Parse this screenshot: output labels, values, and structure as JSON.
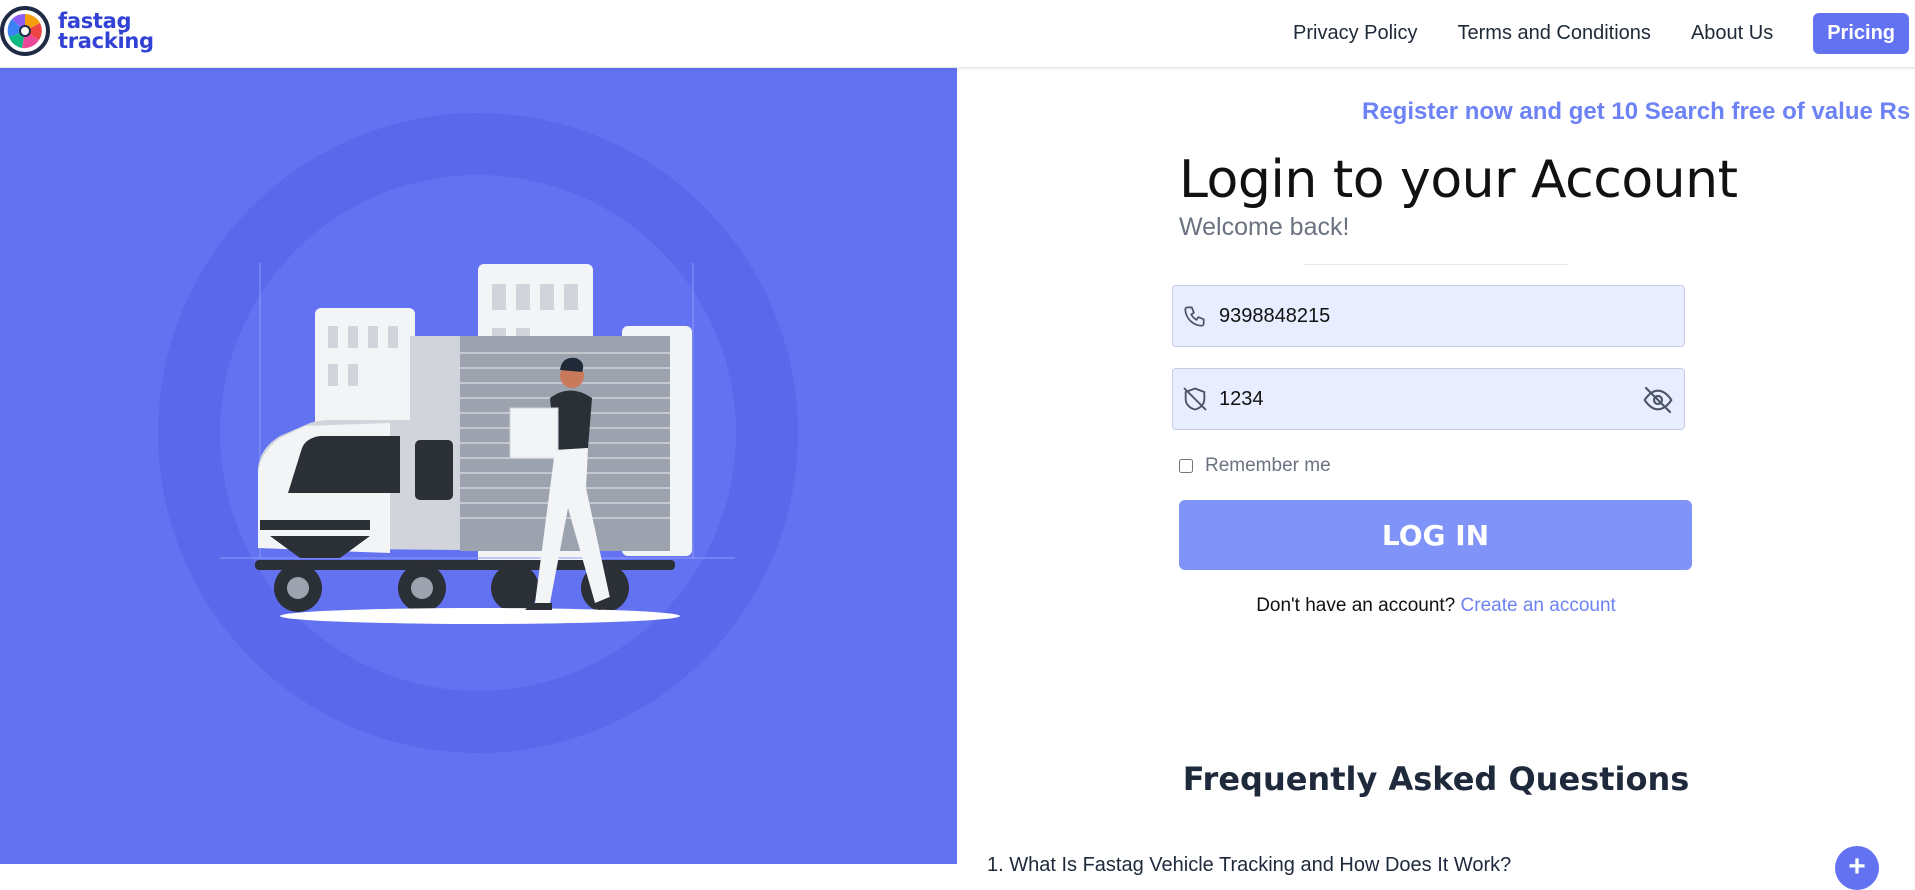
{
  "header": {
    "logo_line1": "fastag",
    "logo_line2": "tracking",
    "nav": {
      "privacy": "Privacy Policy",
      "terms": "Terms and Conditions",
      "about": "About Us",
      "pricing": "Pricing"
    }
  },
  "promo": {
    "marquee": "Register now and get 10 Search free of value Rs -"
  },
  "login": {
    "title": "Login to your Account",
    "subtitle": "Welcome back!",
    "phone_value": "9398848215",
    "password_value": "1234",
    "remember_label": "Remember me",
    "login_button": "LOG IN",
    "no_account_text": "Don't have an account?",
    "create_link": "Create an account"
  },
  "faq": {
    "title": "Frequently Asked Questions",
    "first_question": "1. What Is Fastag Vehicle Tracking and How Does It Work?",
    "expand_symbol": "+"
  },
  "colors": {
    "brand": "#6272f1",
    "button": "#7f93f8",
    "link": "#6c82f5",
    "logo_text": "#3142d4"
  }
}
